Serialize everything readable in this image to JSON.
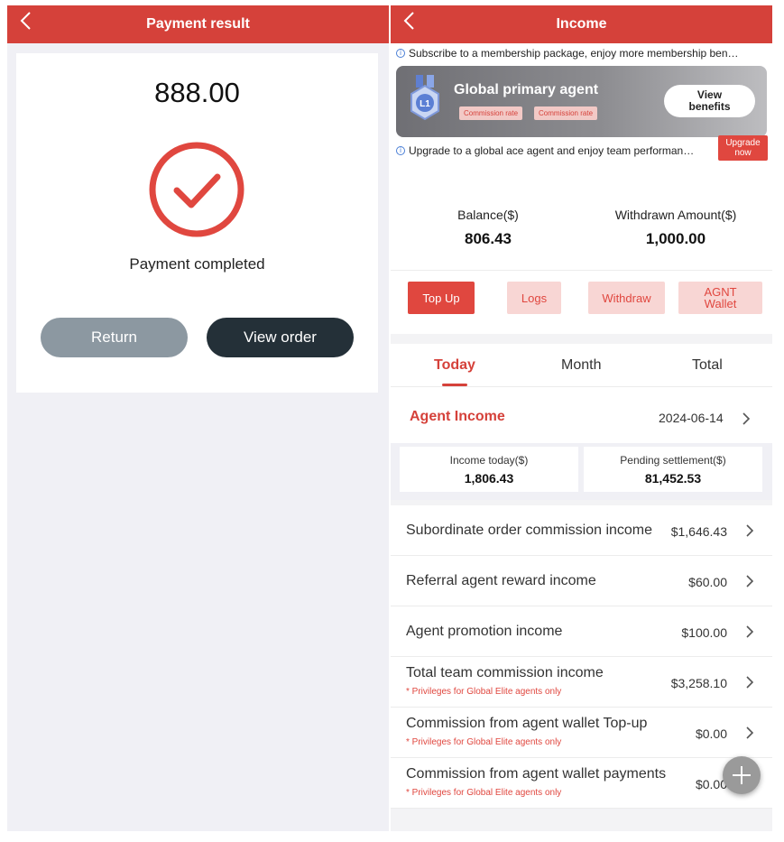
{
  "left": {
    "title": "Payment result",
    "amount": "888.00",
    "status": "Payment completed",
    "return_label": "Return",
    "view_order_label": "View order",
    "colors": {
      "accent": "#d5413a",
      "dark_button": "#243038",
      "gray_button": "#8c98a1"
    }
  },
  "right": {
    "title": "Income",
    "subscribe_notice": "Subscribe to a membership package, enjoy more membership ben…",
    "member": {
      "title": "Global primary agent",
      "medal_text": "L1",
      "tags": [
        "Commission rate",
        "Commission rate"
      ],
      "view_benefits_line1": "View",
      "view_benefits_line2": "benefits"
    },
    "upgrade_notice": "Upgrade to a global ace agent and enjoy team performan…",
    "upgrade_btn_line1": "Upgrade",
    "upgrade_btn_line2": "now",
    "balance": {
      "label": "Balance($)",
      "value": "806.43"
    },
    "withdrawn": {
      "label": "Withdrawn Amount($)",
      "value": "1,000.00"
    },
    "actions": {
      "top_up": "Top Up",
      "logs": "Logs",
      "withdraw": "Withdraw",
      "agnt_line1": "AGNT",
      "agnt_line2": "Wallet"
    },
    "tabs": [
      "Today",
      "Month",
      "Total"
    ],
    "agent_income": {
      "title": "Agent Income",
      "date": "2024-06-14",
      "income_today_label": "Income today($)",
      "income_today_value": "1,806.43",
      "pending_label": "Pending settlement($)",
      "pending_value": "81,452.53"
    },
    "rows": [
      {
        "label": "Subordinate order commission income",
        "amount": "$1,646.43"
      },
      {
        "label": "Referral agent reward income",
        "amount": "$60.00"
      },
      {
        "label": "Agent promotion income",
        "amount": "$100.00"
      },
      {
        "label": "Total team commission income",
        "amount": "$3,258.10",
        "note": "* Privileges for Global Elite agents only"
      },
      {
        "label": "Commission from agent wallet Top-up",
        "amount": "$0.00",
        "note": "* Privileges for Global Elite agents only"
      },
      {
        "label": "Commission from agent wallet payments",
        "amount": "$0.00",
        "note": "* Privileges for Global Elite agents only"
      }
    ],
    "colors": {
      "accent": "#d5413a",
      "light_button": "#f8d6d4",
      "info_blue": "#4a7fd6"
    }
  }
}
